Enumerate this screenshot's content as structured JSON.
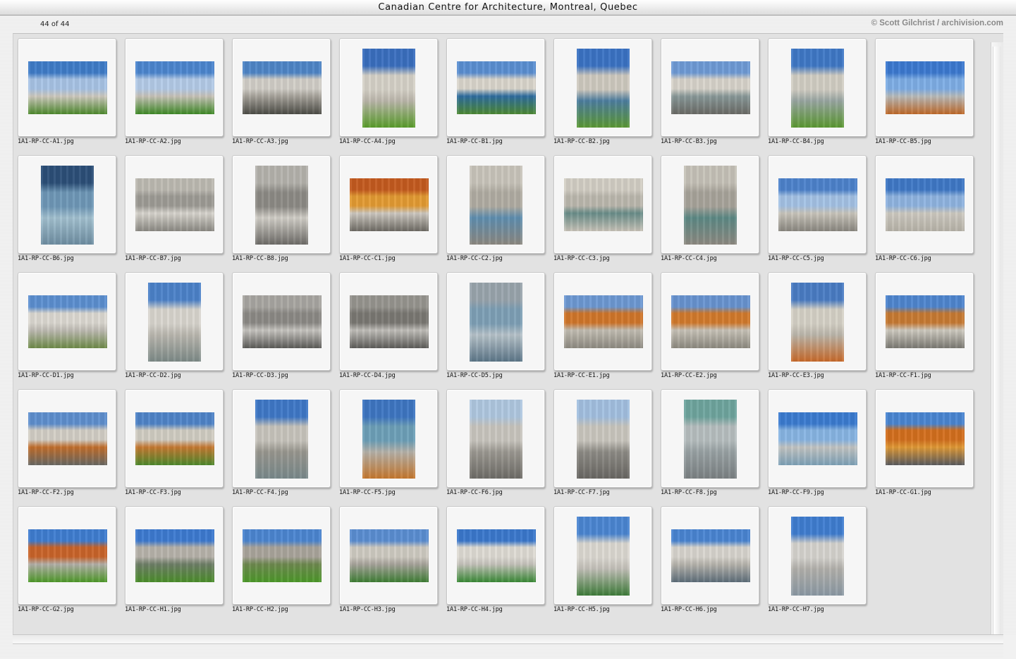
{
  "window": {
    "title": "Canadian Centre for Architecture, Montreal, Quebec"
  },
  "info": {
    "count": "44 of 44",
    "copyright": "© Scott Gilchrist / archivision.com"
  },
  "thumbnails": [
    {
      "file": "1A1-RP-CC-A1.jpg",
      "orientation": "landscape",
      "colors": [
        "#3f7cc8",
        "#a8c4e6",
        "#cfcac0",
        "#4f8a2e"
      ]
    },
    {
      "file": "1A1-RP-CC-A2.jpg",
      "orientation": "landscape",
      "colors": [
        "#4c86cf",
        "#b4cbe8",
        "#c9c4ba",
        "#3f8a27"
      ]
    },
    {
      "file": "1A1-RP-CC-A3.jpg",
      "orientation": "landscape",
      "colors": [
        "#4f86c7",
        "#d2cfc8",
        "#a8a49c",
        "#4d4d47"
      ]
    },
    {
      "file": "1A1-RP-CC-A4.jpg",
      "orientation": "portrait",
      "colors": [
        "#3a6fbf",
        "#d6d2c8",
        "#bdb8ad",
        "#5a9e2b"
      ]
    },
    {
      "file": "1A1-RP-CC-B1.jpg",
      "orientation": "landscape",
      "colors": [
        "#5b8fd2",
        "#dad6cc",
        "#2e6da0",
        "#4e8a34"
      ]
    },
    {
      "file": "1A1-RP-CC-B2.jpg",
      "orientation": "portrait",
      "colors": [
        "#3b73c4",
        "#cfcac0",
        "#4d7ea0",
        "#5d9a36"
      ]
    },
    {
      "file": "1A1-RP-CC-B3.jpg",
      "orientation": "landscape",
      "colors": [
        "#6f9bd6",
        "#d8d4cb",
        "#8a9a9a",
        "#6b6b66"
      ]
    },
    {
      "file": "1A1-RP-CC-B4.jpg",
      "orientation": "portrait",
      "colors": [
        "#3f78c6",
        "#d2cec4",
        "#9aa7a3",
        "#5c9a32"
      ]
    },
    {
      "file": "1A1-RP-CC-B5.jpg",
      "orientation": "landscape",
      "colors": [
        "#3c79d0",
        "#7eaee6",
        "#b9bcbc",
        "#c06a2a"
      ]
    },
    {
      "file": "1A1-RP-CC-B6.jpg",
      "orientation": "portrait",
      "colors": [
        "#2c4f78",
        "#6f98b7",
        "#a4c2d1",
        "#6f8fa3"
      ]
    },
    {
      "file": "1A1-RP-CC-B7.jpg",
      "orientation": "landscape",
      "colors": [
        "#bdbab2",
        "#9e9c96",
        "#d9d6cf",
        "#8b8983"
      ]
    },
    {
      "file": "1A1-RP-CC-B8.jpg",
      "orientation": "portrait",
      "colors": [
        "#b5b3ad",
        "#8d8b86",
        "#d3d0c9",
        "#6f6d69"
      ]
    },
    {
      "file": "1A1-RP-CC-C1.jpg",
      "orientation": "landscape",
      "colors": [
        "#c45b1f",
        "#e39b33",
        "#cfcac2",
        "#6e6b64"
      ]
    },
    {
      "file": "1A1-RP-CC-C2.jpg",
      "orientation": "portrait",
      "colors": [
        "#c9c5bb",
        "#b1ada3",
        "#5f8fb1",
        "#8e8a82"
      ]
    },
    {
      "file": "1A1-RP-CC-C3.jpg",
      "orientation": "landscape",
      "colors": [
        "#d3cfc5",
        "#bcb8ae",
        "#6a8e8a",
        "#c9c4b9"
      ]
    },
    {
      "file": "1A1-RP-CC-C4.jpg",
      "orientation": "portrait",
      "colors": [
        "#c6c2b8",
        "#a8a49b",
        "#5d8a86",
        "#8f8b83"
      ]
    },
    {
      "file": "1A1-RP-CC-C5.jpg",
      "orientation": "landscape",
      "colors": [
        "#4d82cb",
        "#a4c2e5",
        "#cbc7bd",
        "#8a8780"
      ]
    },
    {
      "file": "1A1-RP-CC-C6.jpg",
      "orientation": "landscape",
      "colors": [
        "#3f78c6",
        "#8fb4e0",
        "#cfcbc2",
        "#b7b3a9"
      ]
    },
    {
      "file": "1A1-RP-CC-D1.jpg",
      "orientation": "landscape",
      "colors": [
        "#5c8fd0",
        "#dcd9d2",
        "#c0bdb5",
        "#6f8b4a"
      ]
    },
    {
      "file": "1A1-RP-CC-D2.jpg",
      "orientation": "portrait",
      "colors": [
        "#4c82c9",
        "#d9d6cf",
        "#bcb9b1",
        "#7e8b88"
      ]
    },
    {
      "file": "1A1-RP-CC-D3.jpg",
      "orientation": "landscape",
      "colors": [
        "#a9a7a2",
        "#8c8a86",
        "#c8c6c1",
        "#5d5c59"
      ]
    },
    {
      "file": "1A1-RP-CC-D4.jpg",
      "orientation": "landscape",
      "colors": [
        "#97958f",
        "#7a7873",
        "#c2c0bb",
        "#5e5d5a"
      ]
    },
    {
      "file": "1A1-RP-CC-D5.jpg",
      "orientation": "portrait",
      "colors": [
        "#9aa5ad",
        "#7ea0b6",
        "#b8c4cb",
        "#5d7789"
      ]
    },
    {
      "file": "1A1-RP-CC-E1.jpg",
      "orientation": "landscape",
      "colors": [
        "#6d99d3",
        "#d0762a",
        "#c4bfb4",
        "#8f8b82"
      ]
    },
    {
      "file": "1A1-RP-CC-E2.jpg",
      "orientation": "landscape",
      "colors": [
        "#6894d0",
        "#d27a2c",
        "#c9c4b9",
        "#8d8a80"
      ]
    },
    {
      "file": "1A1-RP-CC-E3.jpg",
      "orientation": "portrait",
      "colors": [
        "#4a7cc4",
        "#d6d2c7",
        "#bdb8ad",
        "#c96b2b"
      ]
    },
    {
      "file": "1A1-RP-CC-F1.jpg",
      "orientation": "landscape",
      "colors": [
        "#4f86cf",
        "#c77a33",
        "#cfcbc1",
        "#7c7a73"
      ]
    },
    {
      "file": "1A1-RP-CC-F2.jpg",
      "orientation": "landscape",
      "colors": [
        "#5f8fce",
        "#d3cfc6",
        "#c36f2c",
        "#6a6964"
      ]
    },
    {
      "file": "1A1-RP-CC-F3.jpg",
      "orientation": "landscape",
      "colors": [
        "#4f84c8",
        "#d1cdc3",
        "#c77931",
        "#4f8a2d"
      ]
    },
    {
      "file": "1A1-RP-CC-F4.jpg",
      "orientation": "portrait",
      "colors": [
        "#3f78c7",
        "#c8c5bd",
        "#9a9890",
        "#7a8a8c"
      ]
    },
    {
      "file": "1A1-RP-CC-F5.jpg",
      "orientation": "portrait",
      "colors": [
        "#3e76c2",
        "#6ea0b8",
        "#b6b3ab",
        "#c7792f"
      ]
    },
    {
      "file": "1A1-RP-CC-F6.jpg",
      "orientation": "portrait",
      "colors": [
        "#b0c8e0",
        "#c9c6bf",
        "#9d9a93",
        "#6f6d68"
      ]
    },
    {
      "file": "1A1-RP-CC-F7.jpg",
      "orientation": "portrait",
      "colors": [
        "#a3c0e0",
        "#cac7bf",
        "#8f8d87",
        "#6a6864"
      ]
    },
    {
      "file": "1A1-RP-CC-F8.jpg",
      "orientation": "portrait",
      "colors": [
        "#6fa59e",
        "#b7bfc0",
        "#9aa3a5",
        "#7c8284"
      ]
    },
    {
      "file": "1A1-RP-CC-F9.jpg",
      "orientation": "landscape",
      "colors": [
        "#3b7bd0",
        "#88b5e3",
        "#c4c6c4",
        "#7ea2b8"
      ]
    },
    {
      "file": "1A1-RP-CC-G1.jpg",
      "orientation": "landscape",
      "colors": [
        "#4a86d2",
        "#d36f1e",
        "#e19a36",
        "#5b5c60"
      ]
    },
    {
      "file": "1A1-RP-CC-G2.jpg",
      "orientation": "landscape",
      "colors": [
        "#3f7dd0",
        "#c9642a",
        "#b5b1aa",
        "#4f9a2a"
      ]
    },
    {
      "file": "1A1-RP-CC-H1.jpg",
      "orientation": "landscape",
      "colors": [
        "#3d7ad0",
        "#b7b3ab",
        "#6f7f68",
        "#4c8f2b"
      ]
    },
    {
      "file": "1A1-RP-CC-H2.jpg",
      "orientation": "landscape",
      "colors": [
        "#4c86d1",
        "#aaa59c",
        "#6f8a50",
        "#4d9a2a"
      ]
    },
    {
      "file": "1A1-RP-CC-H3.jpg",
      "orientation": "landscape",
      "colors": [
        "#5b8ed2",
        "#cfcbc2",
        "#a9a59d",
        "#3f7f35"
      ]
    },
    {
      "file": "1A1-RP-CC-H4.jpg",
      "orientation": "landscape",
      "colors": [
        "#3b78cc",
        "#dedbd4",
        "#c7c4bd",
        "#3a8a36"
      ]
    },
    {
      "file": "1A1-RP-CC-H5.jpg",
      "orientation": "portrait",
      "colors": [
        "#4b86d2",
        "#dcd9d2",
        "#c4c1ba",
        "#3f7d3a"
      ]
    },
    {
      "file": "1A1-RP-CC-H6.jpg",
      "orientation": "landscape",
      "colors": [
        "#4a85d2",
        "#d8d5ce",
        "#b9b6af",
        "#5e6e7a"
      ]
    },
    {
      "file": "1A1-RP-CC-H7.jpg",
      "orientation": "portrait",
      "colors": [
        "#3f7dd0",
        "#d6d4cf",
        "#b4b2ad",
        "#8c9aa5"
      ]
    }
  ]
}
